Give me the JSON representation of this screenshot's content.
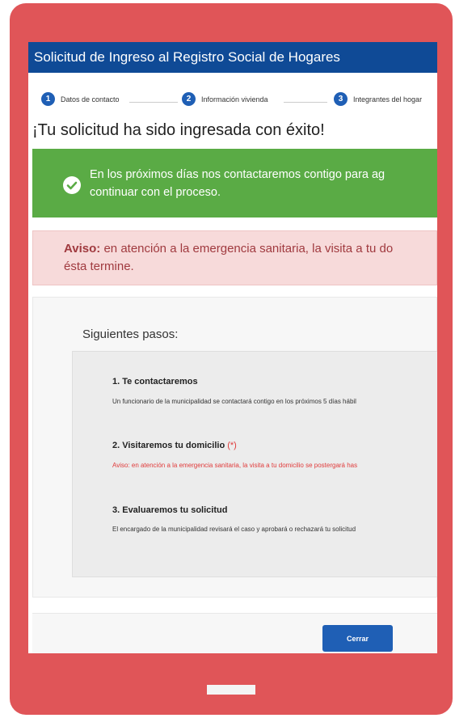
{
  "header": {
    "title": "Solicitud de Ingreso al Registro Social de Hogares"
  },
  "stepper": [
    {
      "number": "1",
      "label": "Datos de contacto"
    },
    {
      "number": "2",
      "label": "Información vivienda"
    },
    {
      "number": "3",
      "label": "Integrantes del hogar"
    }
  ],
  "success": {
    "title": "¡Tu solicitud ha sido ingresada con éxito!"
  },
  "green_alert": {
    "line1": "En los próximos días nos contactaremos contigo para ag",
    "line2": "continuar con el proceso."
  },
  "warning": {
    "prefix": "Aviso:",
    "line1": " en atención a la emergencia sanitaria, la visita a tu do",
    "line2": "ésta termine."
  },
  "next_steps": {
    "title": "Siguientes pasos:",
    "items": [
      {
        "title": "1. Te contactaremos",
        "desc": "Un funcionario de la municipalidad se contactará contigo en los próximos 5 días hábil"
      },
      {
        "title": "2. Visitaremos tu domicilio",
        "marker": "(*)",
        "desc": "Aviso: en atención a la emergencia sanitaria, la visita a tu domicilio se postergará has"
      },
      {
        "title": "3. Evaluaremos tu solicitud",
        "desc": "El encargado de la municipalidad revisará el caso y aprobará o rechazará tu solicitud"
      }
    ]
  },
  "footer": {
    "close_label": "Cerrar"
  },
  "colors": {
    "header": "#0f4a96",
    "success": "#5aab45",
    "warning_bg": "#f7dada",
    "primary": "#1f5fb5",
    "device": "#e05558"
  }
}
